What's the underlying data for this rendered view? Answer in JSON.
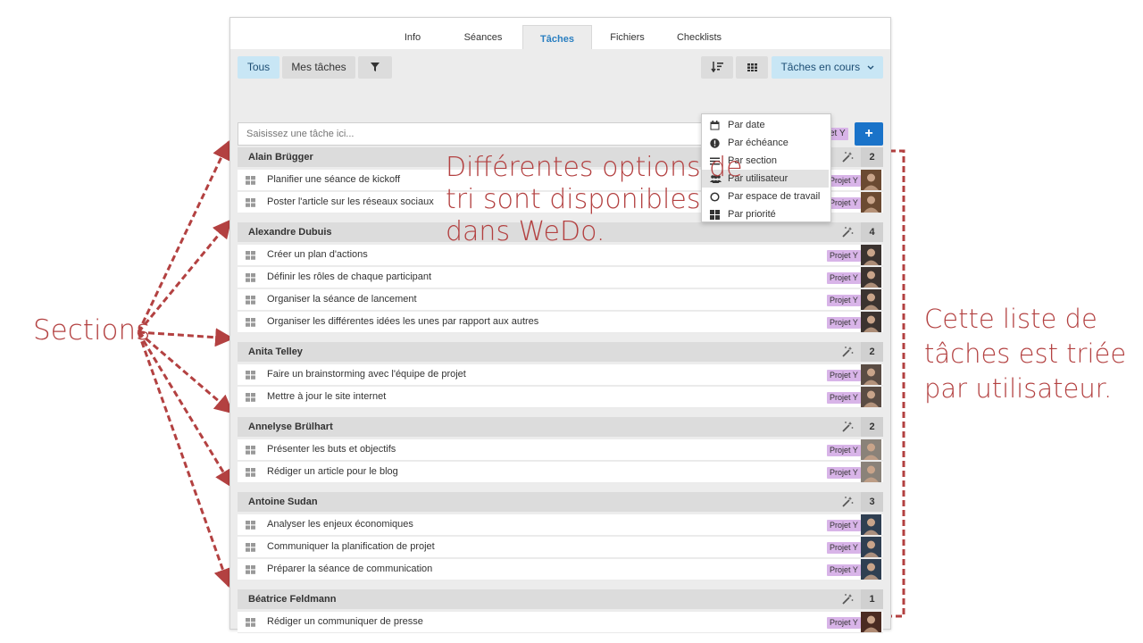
{
  "tabs": [
    {
      "label": "Info"
    },
    {
      "label": "Séances"
    },
    {
      "label": "Tâches"
    },
    {
      "label": "Fichiers"
    },
    {
      "label": "Checklists"
    }
  ],
  "toolbar": {
    "all_label": "Tous",
    "my_tasks_label": "Mes tâches",
    "status_label": "Tâches en cours"
  },
  "task_input": {
    "placeholder": "Saisissez une tâche ici...",
    "tag": "et Y",
    "add_label": "+"
  },
  "sort_menu": {
    "items": [
      {
        "label": "Par date",
        "icon": "calendar-icon"
      },
      {
        "label": "Par échéance",
        "icon": "exclamation-circle-icon"
      },
      {
        "label": "Par section",
        "icon": "list-icon"
      },
      {
        "label": "Par utilisateur",
        "icon": "users-icon"
      },
      {
        "label": "Par espace de travail",
        "icon": "circle-outline-icon"
      },
      {
        "label": "Par priorité",
        "icon": "grid-icon"
      }
    ],
    "selected": "Par utilisateur"
  },
  "sections": [
    {
      "title": "Alain Brügger",
      "count": "2",
      "tasks": [
        {
          "name": "Planifier une séance de kickoff",
          "tag": "Projet Y"
        },
        {
          "name": "Poster l'article sur les réseaux sociaux",
          "tag": "Projet Y"
        }
      ]
    },
    {
      "title": "Alexandre Dubuis",
      "count": "4",
      "tasks": [
        {
          "name": "Créer un plan d'actions",
          "tag": "Projet Y"
        },
        {
          "name": "Définir les rôles de chaque participant",
          "tag": "Projet Y"
        },
        {
          "name": "Organiser la séance de lancement",
          "tag": "Projet Y"
        },
        {
          "name": "Organiser les différentes idées les unes par rapport aux autres",
          "tag": "Projet Y"
        }
      ]
    },
    {
      "title": "Anita Telley",
      "count": "2",
      "tasks": [
        {
          "name": "Faire un brainstorming avec l'équipe de projet",
          "tag": "Projet Y"
        },
        {
          "name": "Mettre à jour le site internet",
          "tag": "Projet Y"
        }
      ]
    },
    {
      "title": "Annelyse Brülhart",
      "count": "2",
      "tasks": [
        {
          "name": "Présenter les buts et objectifs",
          "tag": "Projet Y"
        },
        {
          "name": "Rédiger un article pour le blog",
          "tag": "Projet Y"
        }
      ]
    },
    {
      "title": "Antoine Sudan",
      "count": "3",
      "tasks": [
        {
          "name": "Analyser les enjeux économiques",
          "tag": "Projet Y"
        },
        {
          "name": "Communiquer la planification de projet",
          "tag": "Projet Y"
        },
        {
          "name": "Préparer la séance de communication",
          "tag": "Projet Y"
        }
      ]
    },
    {
      "title": "Béatrice Feldmann",
      "count": "1",
      "tasks": [
        {
          "name": "Rédiger un communiquer de presse",
          "tag": "Projet Y"
        }
      ]
    }
  ],
  "annotations": {
    "sections_label": "Sections",
    "sort_note": [
      "Différentes options de",
      "tri sont disponibles",
      "dans WeDo."
    ],
    "list_note": [
      "Cette liste de",
      "tâches est triée",
      "par utilisateur."
    ]
  },
  "colors": {
    "annotation_red": "#b34141",
    "tag_purple": "#d8b4e8",
    "accent_blue": "#1a73c9",
    "light_blue": "#c8e6f5"
  }
}
